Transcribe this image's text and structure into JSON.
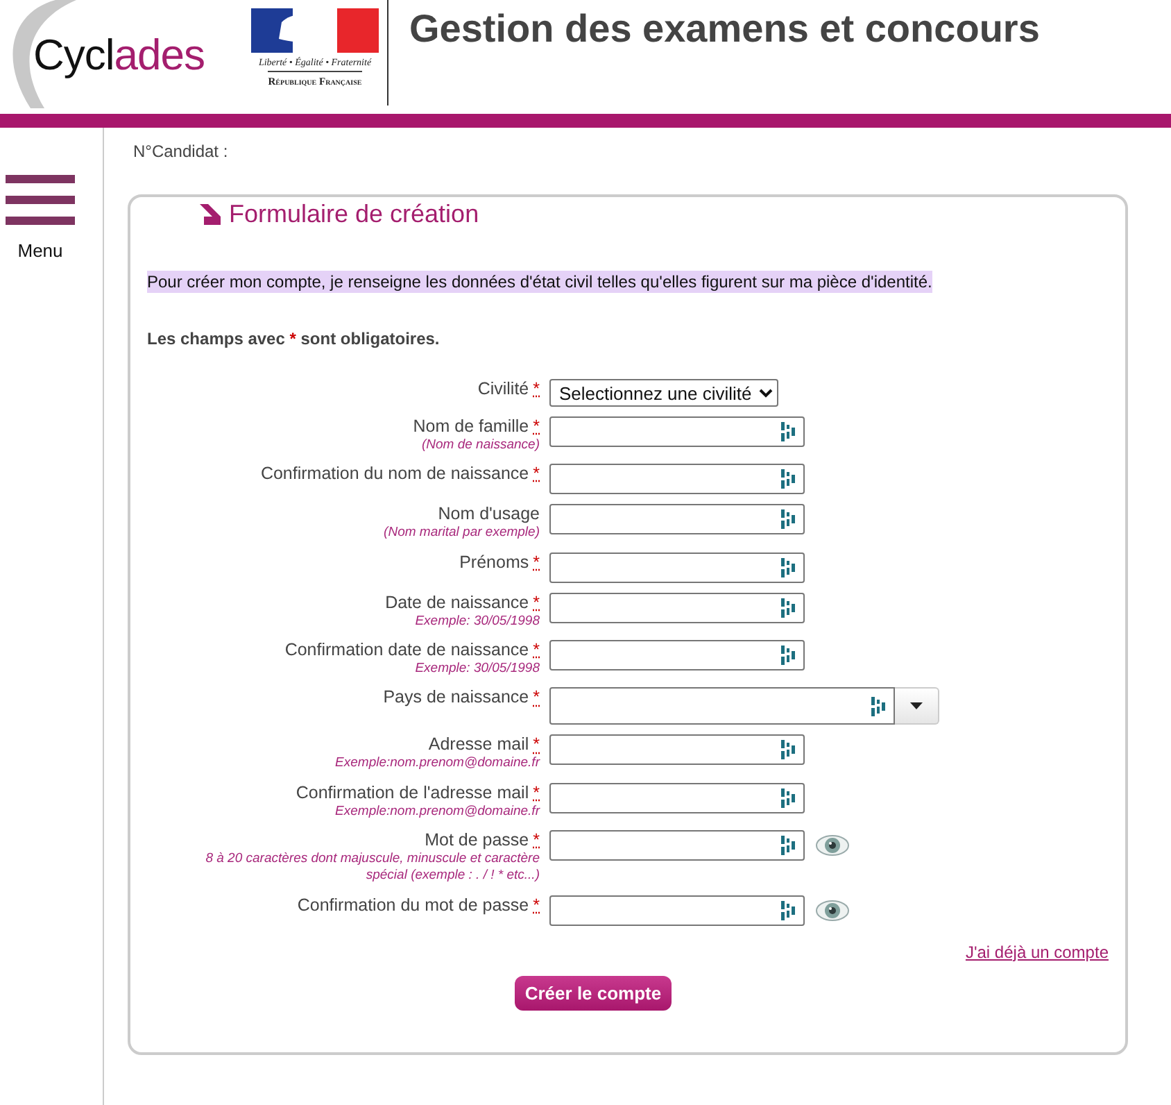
{
  "header": {
    "logo_start": "Cycl",
    "logo_end": "ades",
    "motto": "Liberté • Égalité • Fraternité",
    "republic": "République Française",
    "title": "Gestion des examens et concours"
  },
  "sidebar": {
    "menu_label": "Menu"
  },
  "candidate_label": "N°Candidat :",
  "form": {
    "legend": "Formulaire de création",
    "intro": "Pour créer mon compte, je renseigne les données d'état civil telles qu'elles figurent sur ma pièce d'identité.",
    "note_before": "Les champs avec ",
    "note_mark": "*",
    "note_after": " sont obligatoires.",
    "required_mark": "*",
    "fields": [
      {
        "kind": "select",
        "label": "Civilité",
        "required": true,
        "value": "Selectionnez une civilité"
      },
      {
        "kind": "text",
        "label": "Nom de famille",
        "required": true,
        "hint": "(Nom de naissance)"
      },
      {
        "kind": "text",
        "label": "Confirmation du nom de naissance",
        "required": true
      },
      {
        "kind": "text",
        "label": "Nom d'usage",
        "required": false,
        "hint": "(Nom marital par exemple)"
      },
      {
        "kind": "text",
        "label": "Prénoms",
        "required": true
      },
      {
        "kind": "text",
        "label": "Date de naissance",
        "required": true,
        "hint": "Exemple: 30/05/1998"
      },
      {
        "kind": "text",
        "label": "Confirmation date de naissance",
        "required": true,
        "hint": "Exemple: 30/05/1998"
      },
      {
        "kind": "combo",
        "label": "Pays de naissance",
        "required": true
      },
      {
        "kind": "text",
        "label": "Adresse mail",
        "required": true,
        "hint": "Exemple:nom.prenom@domaine.fr"
      },
      {
        "kind": "text",
        "label": "Confirmation de l'adresse mail",
        "required": true,
        "hint": "Exemple:nom.prenom@domaine.fr"
      },
      {
        "kind": "password",
        "label": "Mot de passe",
        "required": true,
        "hint": "8 à 20 caractères dont majuscule, minuscule et caractère spécial (exemple : . / ! * etc...)"
      },
      {
        "kind": "password",
        "label": "Confirmation du mot de passe",
        "required": true
      }
    ],
    "login_link": "J'ai déjà un compte",
    "submit": "Créer le compte"
  }
}
